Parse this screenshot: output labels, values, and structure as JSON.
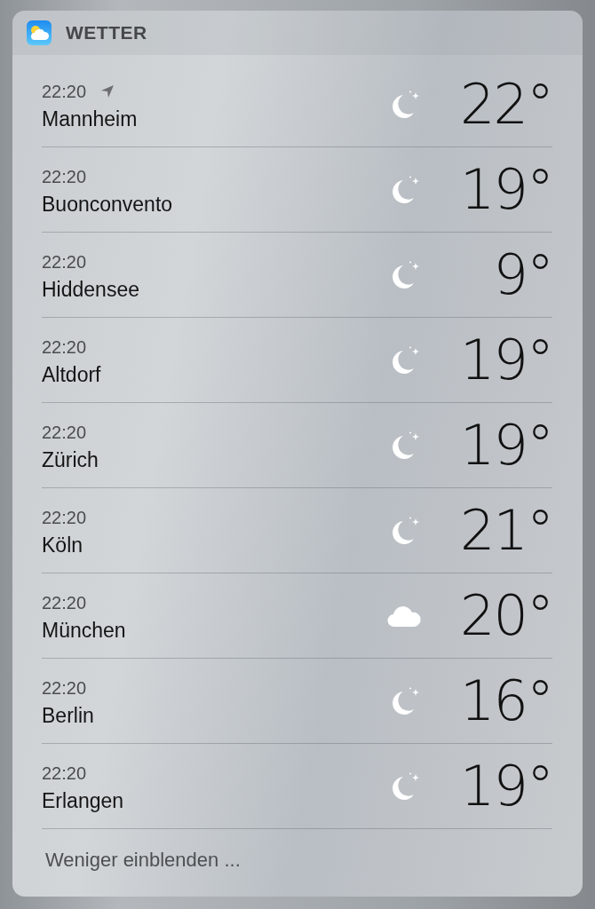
{
  "header": {
    "title": "WETTER"
  },
  "locations": [
    {
      "time": "22:20",
      "current_location": true,
      "city": "Mannheim",
      "kind": "clear-night",
      "temperature": "22°"
    },
    {
      "time": "22:20",
      "current_location": false,
      "city": "Buonconvento",
      "kind": "clear-night",
      "temperature": "19°"
    },
    {
      "time": "22:20",
      "current_location": false,
      "city": "Hiddensee",
      "kind": "clear-night",
      "temperature": "9°"
    },
    {
      "time": "22:20",
      "current_location": false,
      "city": "Altdorf",
      "kind": "clear-night",
      "temperature": "19°"
    },
    {
      "time": "22:20",
      "current_location": false,
      "city": "Zürich",
      "kind": "clear-night",
      "temperature": "19°"
    },
    {
      "time": "22:20",
      "current_location": false,
      "city": "Köln",
      "kind": "clear-night",
      "temperature": "21°"
    },
    {
      "time": "22:20",
      "current_location": false,
      "city": "München",
      "kind": "cloudy",
      "temperature": "20°"
    },
    {
      "time": "22:20",
      "current_location": false,
      "city": "Berlin",
      "kind": "clear-night",
      "temperature": "16°"
    },
    {
      "time": "22:20",
      "current_location": false,
      "city": "Erlangen",
      "kind": "clear-night",
      "temperature": "19°"
    }
  ],
  "footer": {
    "link": "Weniger einblenden ..."
  }
}
